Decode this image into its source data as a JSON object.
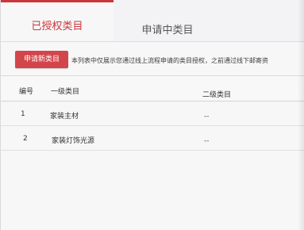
{
  "tabs": {
    "authorized": "已授权类目",
    "applying": "申请中类目"
  },
  "toolbar": {
    "apply_button": "申请新类目",
    "notice": "本列表中仅展示您通过线上流程申请的类目授权，之前通过线下邮寄资"
  },
  "table": {
    "headers": {
      "number": "编号",
      "level1": "一级类目",
      "level2": "二级类目"
    },
    "rows": [
      {
        "number": "1",
        "level1": "家装主材",
        "level2": "--"
      },
      {
        "number": "2",
        "level1": "家装灯饰光源",
        "level2": "--"
      }
    ]
  },
  "colors": {
    "accent": "#c9373c",
    "button": "#d2464b",
    "background": "#f7f7f8"
  }
}
